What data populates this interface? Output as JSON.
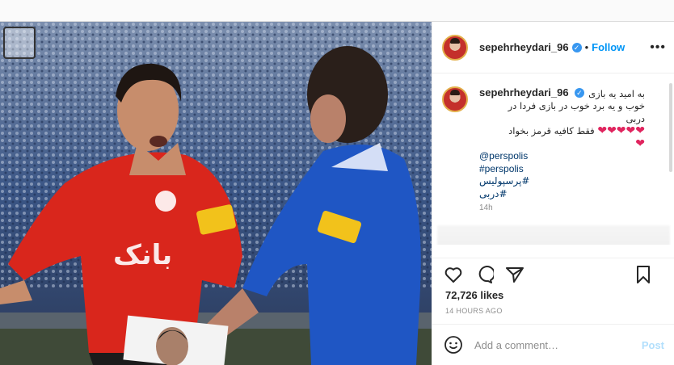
{
  "post": {
    "username": "sepehrheydari_96",
    "follow_label": "Follow",
    "caption": {
      "line1": "به امید یه بازی",
      "line2": "خوب و یه برد خوب در بازی فردا در",
      "line3": "دربی",
      "line4": "فقط کافیه قرمز بخواد",
      "hearts": "❤❤❤❤❤",
      "heart2": "❤",
      "tags": [
        "@perspolis",
        "#perspolis",
        "#پرسپولیس",
        "#دربی"
      ],
      "time": "14h"
    },
    "likes": "72,726 likes",
    "posted": "14 HOURS AGO",
    "comment_placeholder": "Add a comment…",
    "post_label": "Post"
  },
  "colors": {
    "accent": "#0095f6",
    "red_kit": "#d9261c",
    "blue_kit": "#1f56c4"
  },
  "icons": [
    "heart-icon",
    "comment-icon",
    "share-icon",
    "bookmark-icon",
    "emoji-icon",
    "more-icon",
    "verified-icon"
  ]
}
